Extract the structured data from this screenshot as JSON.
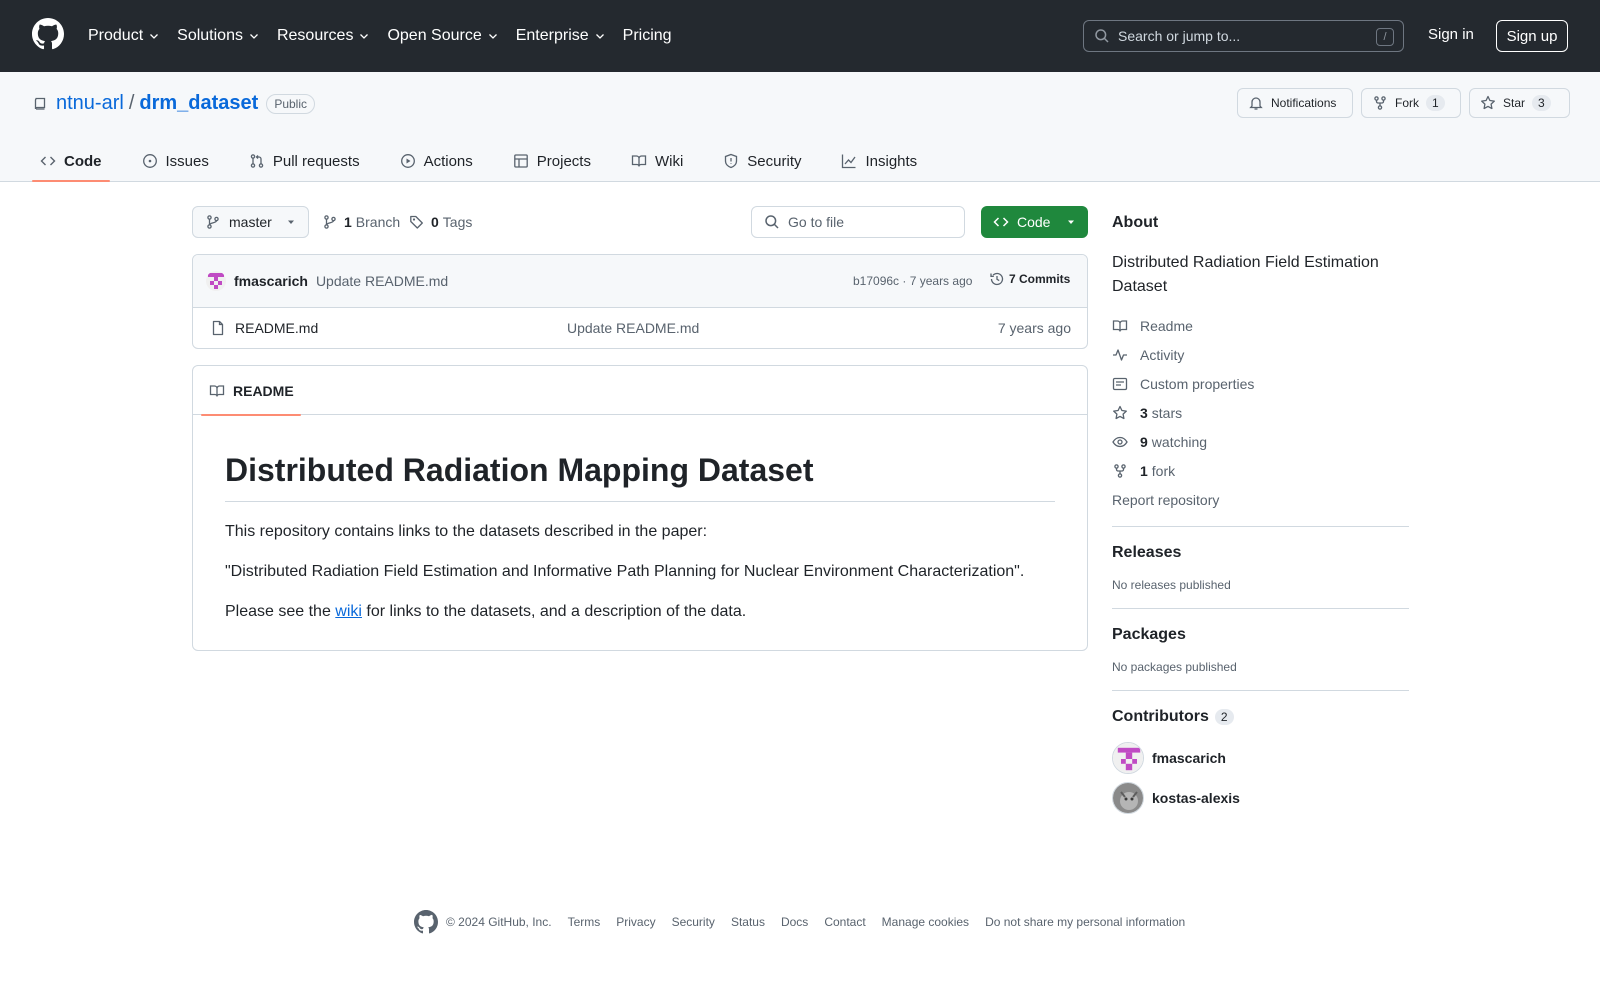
{
  "header": {
    "nav": [
      "Product",
      "Solutions",
      "Resources",
      "Open Source",
      "Enterprise",
      "Pricing"
    ],
    "search_placeholder": "Search or jump to...",
    "search_shortcut": "/",
    "signin": "Sign in",
    "signup": "Sign up"
  },
  "repo": {
    "owner": "ntnu-arl",
    "separator": "/",
    "name": "drm_dataset",
    "visibility": "Public",
    "notifications_label": "Notifications",
    "fork_label": "Fork",
    "fork_count": "1",
    "star_label": "Star",
    "star_count": "3"
  },
  "tabs": [
    "Code",
    "Issues",
    "Pull requests",
    "Actions",
    "Projects",
    "Wiki",
    "Security",
    "Insights"
  ],
  "toolbar": {
    "branch": "master",
    "branch_count": "1",
    "branch_label": "Branch",
    "tag_count": "0",
    "tag_label": "Tags",
    "goto_placeholder": "Go to file",
    "code_label": "Code"
  },
  "commit": {
    "author": "fmascarich",
    "message": "Update README.md",
    "hash_age": "b17096c · 7 years ago",
    "commits_label": "7 Commits"
  },
  "files": [
    {
      "name": "README.md",
      "message": "Update README.md",
      "age": "7 years ago"
    }
  ],
  "readme": {
    "tab_label": "README",
    "heading": "Distributed Radiation Mapping Dataset",
    "p1": "This repository contains links to the datasets described in the paper:",
    "p2": "\"Distributed Radiation Field Estimation and Informative Path Planning for Nuclear Environment Characterization\".",
    "p3_before": "Please see the ",
    "p3_link": "wiki",
    "p3_after": " for links to the datasets, and a description of the data."
  },
  "sidebar": {
    "about_title": "About",
    "description": "Distributed Radiation Field Estimation Dataset",
    "items": [
      {
        "icon": "book-icon",
        "count": "",
        "label": "Readme"
      },
      {
        "icon": "pulse-icon",
        "count": "",
        "label": "Activity"
      },
      {
        "icon": "note-icon",
        "count": "",
        "label": "Custom properties"
      },
      {
        "icon": "star-icon",
        "count": "3",
        "label": "stars"
      },
      {
        "icon": "eye-icon",
        "count": "9",
        "label": "watching"
      },
      {
        "icon": "fork-icon",
        "count": "1",
        "label": "fork"
      }
    ],
    "report": "Report repository",
    "releases_title": "Releases",
    "releases_empty": "No releases published",
    "packages_title": "Packages",
    "packages_empty": "No packages published",
    "contributors_title": "Contributors",
    "contributors_count": "2",
    "contributors": [
      "fmascarich",
      "kostas-alexis"
    ]
  },
  "footer": {
    "copyright": "© 2024 GitHub, Inc.",
    "links": [
      "Terms",
      "Privacy",
      "Security",
      "Status",
      "Docs",
      "Contact",
      "Manage cookies",
      "Do not share my personal information"
    ]
  },
  "colors": {
    "header_bg": "#24292f",
    "link": "#0969da",
    "code_button": "#1f883d",
    "active_tab_underline": "#fd8c73",
    "muted_text": "#59636e",
    "border": "#d1d9e0"
  }
}
